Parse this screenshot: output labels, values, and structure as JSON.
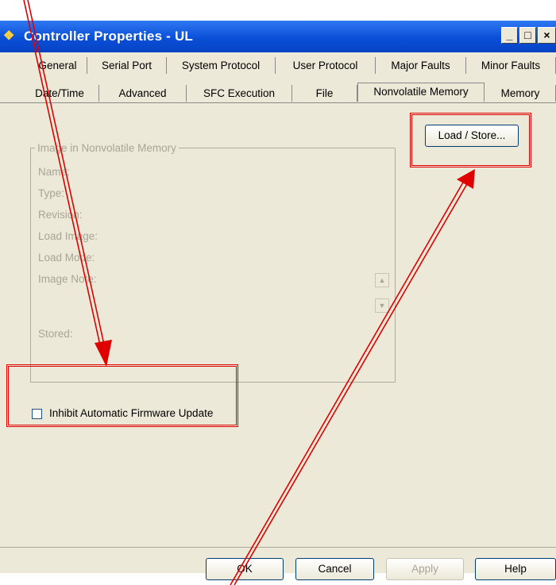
{
  "window": {
    "title": "Controller Properties - UL",
    "icon": "controller-app-icon",
    "controls": {
      "minimize": "_",
      "maximize": "□",
      "close": "×"
    }
  },
  "tabs_row1": [
    "General",
    "Serial Port",
    "System Protocol",
    "User Protocol",
    "Major Faults",
    "Minor Faults"
  ],
  "tabs_row2": [
    "Date/Time",
    "Advanced",
    "SFC Execution",
    "File",
    "Nonvolatile Memory",
    "Memory"
  ],
  "active_tab": "Nonvolatile Memory",
  "group": {
    "legend": "Image in Nonvolatile Memory",
    "fields": {
      "name": "Name:",
      "type": "Type:",
      "revision": "Revision:",
      "load_image": "Load Image:",
      "load_mode": "Load Mode:",
      "image_note": "Image Note:",
      "stored": "Stored:"
    }
  },
  "load_store_button": "Load / Store...",
  "checkbox": {
    "label": "Inhibit Automatic Firmware Update",
    "checked": false
  },
  "footer": {
    "ok": "OK",
    "cancel": "Cancel",
    "apply": "Apply",
    "help": "Help"
  },
  "annotation_color": "#e00000"
}
